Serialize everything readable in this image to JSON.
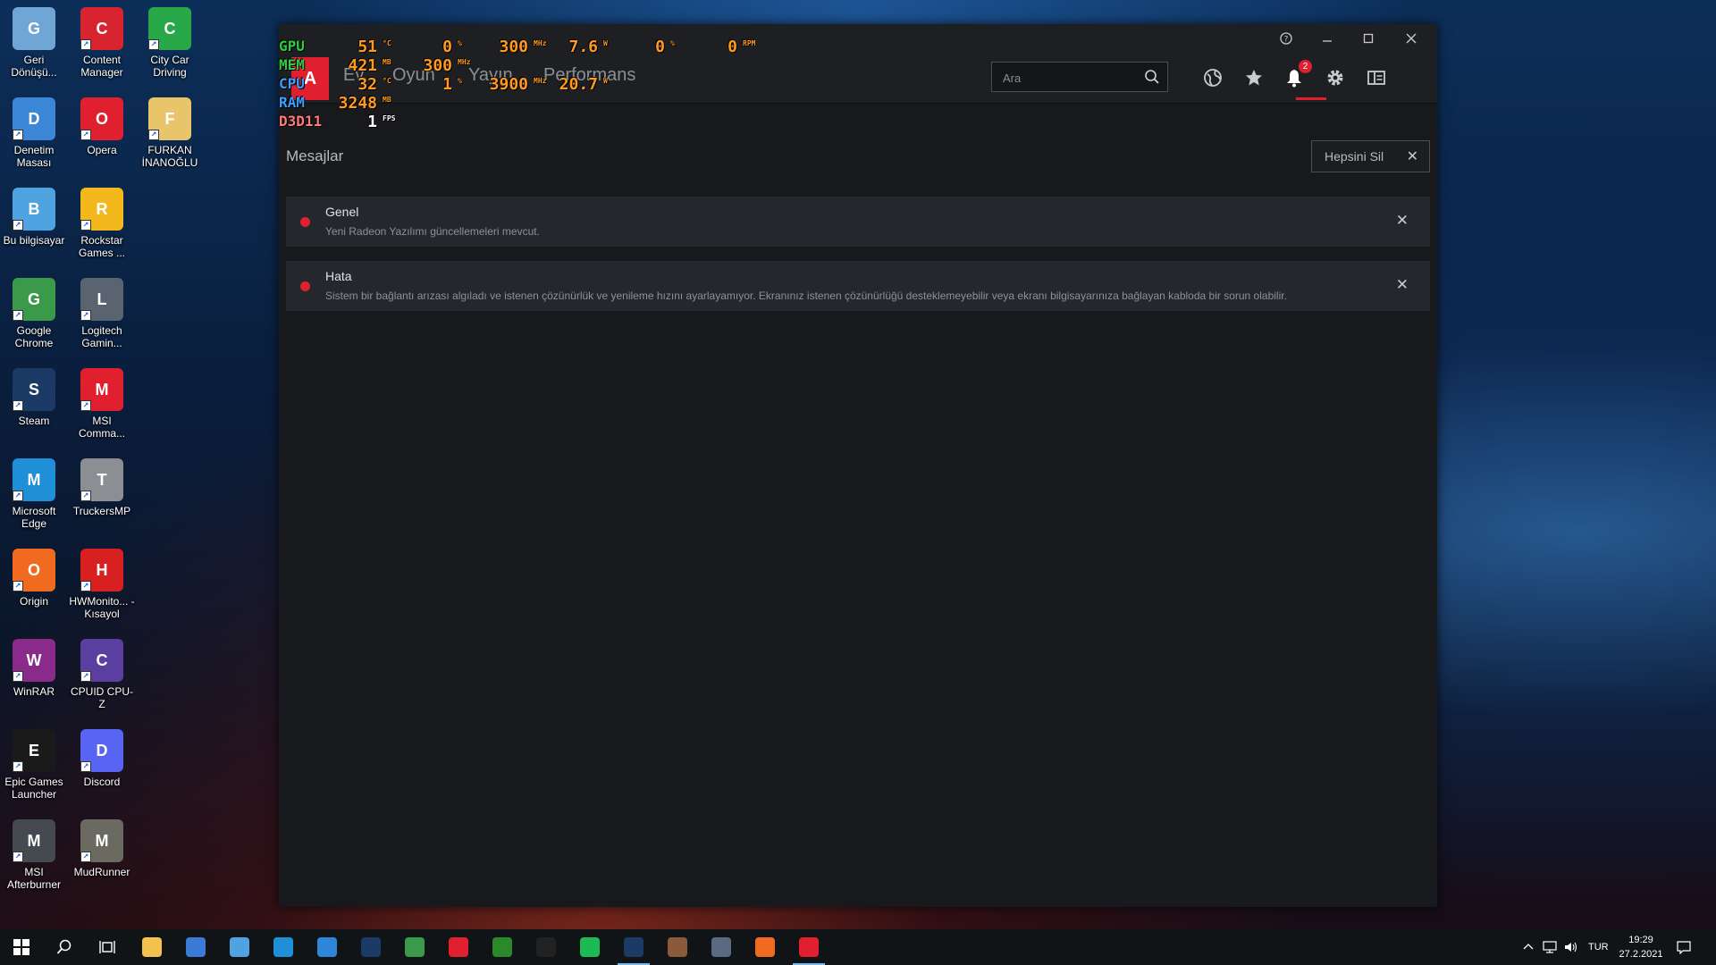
{
  "desktop": {
    "icons": [
      {
        "label": "Geri Dönüşü...",
        "icon": "recycle-bin-icon",
        "color": "#6fa6d6"
      },
      {
        "label": "Content Manager",
        "icon": "content-manager-icon",
        "color": "#d8242e"
      },
      {
        "label": "City Car Driving",
        "icon": "city-car-driving-icon",
        "color": "#29a84a"
      },
      {
        "label": "Denetim Masası",
        "icon": "control-panel-icon",
        "color": "#3b86d6"
      },
      {
        "label": "Opera",
        "icon": "opera-icon",
        "color": "#e0202e"
      },
      {
        "label": "FURKAN İNANOĞLU",
        "icon": "folder-icon",
        "color": "#e8c46a"
      },
      {
        "label": "Bu bilgisayar",
        "icon": "this-pc-icon",
        "color": "#4fa3e0"
      },
      {
        "label": "Rockstar Games ...",
        "icon": "rockstar-icon",
        "color": "#f2b81c"
      },
      {
        "label": "Google Chrome",
        "icon": "chrome-icon",
        "color": "#3a9a4a"
      },
      {
        "label": "Logitech Gamin...",
        "icon": "logitech-icon",
        "color": "#5a6470"
      },
      {
        "label": "Steam",
        "icon": "steam-icon",
        "color": "#1b3a66"
      },
      {
        "label": "MSI Comma...",
        "icon": "msi-command-icon",
        "color": "#e0202e"
      },
      {
        "label": "Microsoft Edge",
        "icon": "edge-icon",
        "color": "#1f8fd8"
      },
      {
        "label": "TruckersMP",
        "icon": "truckersmp-icon",
        "color": "#8b8f94"
      },
      {
        "label": "Origin",
        "icon": "origin-icon",
        "color": "#f06a20"
      },
      {
        "label": "HWMonito... - Kısayol",
        "icon": "hwmonitor-icon",
        "color": "#d82020"
      },
      {
        "label": "WinRAR",
        "icon": "winrar-icon",
        "color": "#8a2a8a"
      },
      {
        "label": "CPUID CPU-Z",
        "icon": "cpuz-icon",
        "color": "#5a3fa0"
      },
      {
        "label": "Epic Games Launcher",
        "icon": "epic-games-icon",
        "color": "#1a1a1a"
      },
      {
        "label": "Discord",
        "icon": "discord-icon",
        "color": "#5865f2"
      },
      {
        "label": "MSI Afterburner",
        "icon": "afterburner-icon",
        "color": "#444a50"
      },
      {
        "label": "MudRunner",
        "icon": "mudrunner-icon",
        "color": "#6a6a60"
      }
    ]
  },
  "osd": {
    "rows": [
      {
        "label": "GPU",
        "label_color": "#2ecc40",
        "values": [
          {
            "v": "51",
            "u": "°C"
          },
          {
            "v": "0",
            "u": "%"
          },
          {
            "v": "300",
            "u": "MHz"
          },
          {
            "v": "7.6",
            "u": "W"
          },
          {
            "v": "0",
            "u": "%"
          },
          {
            "v": "0",
            "u": "RPM"
          }
        ]
      },
      {
        "label": "MEM",
        "label_color": "#2ecc40",
        "values": [
          {
            "v": "421",
            "u": "MB"
          },
          {
            "v": "300",
            "u": "MHz"
          }
        ]
      },
      {
        "label": "CPU",
        "label_color": "#3aa0ff",
        "values": [
          {
            "v": "32",
            "u": "°C"
          },
          {
            "v": "1",
            "u": "%"
          },
          {
            "v": "3900",
            "u": "MHz"
          },
          {
            "v": "20.7",
            "u": "W"
          }
        ]
      },
      {
        "label": "RAM",
        "label_color": "#3aa0ff",
        "values": [
          {
            "v": "3248",
            "u": "MB"
          }
        ]
      },
      {
        "label": "D3D11",
        "label_color": "#ff7a7a",
        "values": [
          {
            "v": "1",
            "u": "FPS"
          }
        ]
      }
    ]
  },
  "radeon": {
    "logo": "A",
    "tabs": [
      "Ev",
      "Oyun",
      "Yayın",
      "Performans"
    ],
    "search": {
      "placeholder": "Ara"
    },
    "notification_count": "2",
    "page_title": "Mesajlar",
    "clear_all_label": "Hepsini Sil",
    "messages": [
      {
        "title": "Genel",
        "text": "Yeni Radeon Yazılımı güncellemeleri mevcut."
      },
      {
        "title": "Hata",
        "text": "Sistem bir bağlantı arızası algıladı ve istenen çözünürlük ve yenileme hızını ayarlayamıyor. Ekranınız istenen çözünürlüğü desteklemeyebilir veya ekranı bilgisayarınıza bağlayan kabloda bir sorun olabilir."
      }
    ],
    "accent": "#e0202e"
  },
  "taskbar": {
    "language": "TUR",
    "time": "19:29",
    "date": "27.2.2021",
    "apps": [
      {
        "icon": "file-explorer-icon",
        "color": "#f2c14e"
      },
      {
        "icon": "store-icon",
        "color": "#3a7bd5"
      },
      {
        "icon": "computer-icon",
        "color": "#4fa3e0"
      },
      {
        "icon": "edge-icon",
        "color": "#1f8fd8"
      },
      {
        "icon": "mail-icon",
        "color": "#2f86d8"
      },
      {
        "icon": "steam-icon",
        "color": "#1b3a66"
      },
      {
        "icon": "chrome-icon",
        "color": "#3a9a4a"
      },
      {
        "icon": "msi-command-icon",
        "color": "#e0202e"
      },
      {
        "icon": "xbox-icon",
        "color": "#2a8a2a"
      },
      {
        "icon": "epic-games-icon",
        "color": "#222222"
      },
      {
        "icon": "spotify-icon",
        "color": "#1db954"
      },
      {
        "icon": "steam-icon",
        "color": "#1b3a66"
      },
      {
        "icon": "game-icon",
        "color": "#8a5a3a"
      },
      {
        "icon": "calculator-icon",
        "color": "#5a6a80"
      },
      {
        "icon": "origin-icon",
        "color": "#f06a20"
      },
      {
        "icon": "radeon-icon",
        "color": "#e0202e"
      }
    ]
  }
}
